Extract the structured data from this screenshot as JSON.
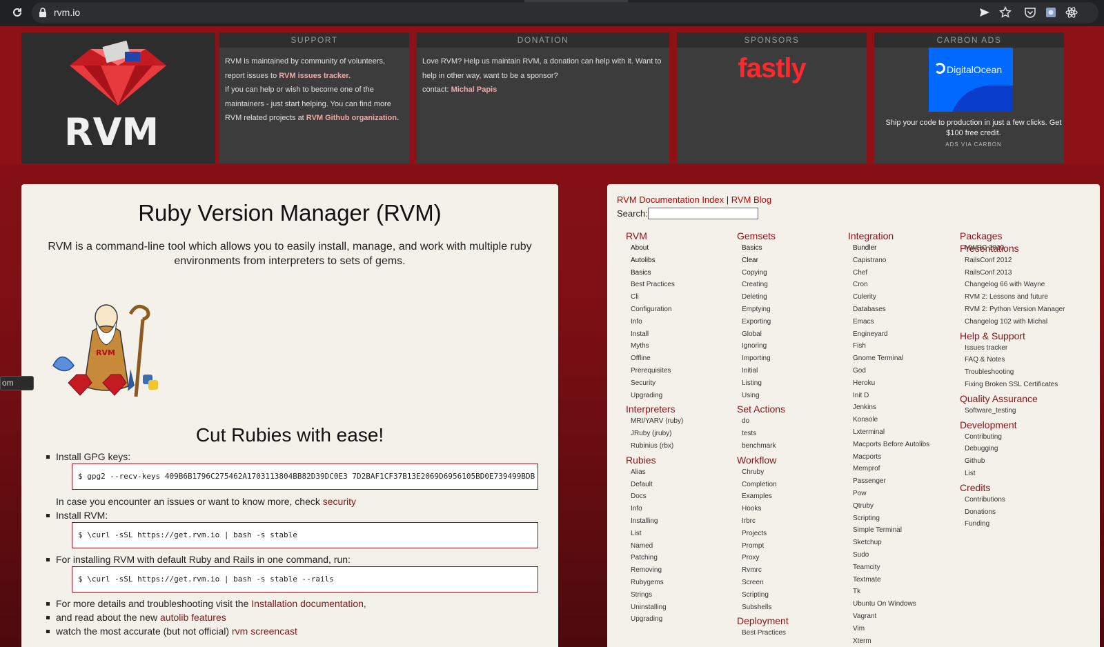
{
  "browser": {
    "url": "rvm.io"
  },
  "top": {
    "support": {
      "title": "SUPPORT",
      "line1": "RVM is maintained by community of volunteers,",
      "line2a": "report issues to ",
      "link_tracker": "RVM issues tracker.",
      "line3": "If you can help or wish to become one of the",
      "line4": "maintainers - just start helping. You can find more",
      "line5a": "RVM related projects at ",
      "link_github": "RVM Github organization."
    },
    "donation": {
      "title": "DONATION",
      "line1": "Love RVM? Help us maintain RVM, a donation can help with it. Want to",
      "line2": "help in other way, want to be a sponsor?",
      "line3a": "contact: ",
      "link_contact": "Michal Papis"
    },
    "sponsors": {
      "title": "SPONSORS",
      "name": "fastly"
    },
    "carbon": {
      "title": "CARBON ADS",
      "brand": "DigitalOcean",
      "text": "Ship your code to production in just a few clicks. Get $100 free credit.",
      "via": "ADS VIA CARBON"
    }
  },
  "main": {
    "title": "Ruby Version Manager (RVM)",
    "intro": "RVM is a command-line tool which allows you to easily install, manage, and work with multiple ruby environments from interpreters to sets of gems.",
    "subtitle": "Cut Rubies with ease!",
    "gpg_label": "Install GPG keys:",
    "gpg_code": "$ gpg2 --recv-keys 409B6B1796C275462A1703113804BB82D39DC0E3 7D2BAF1CF37B13E2069D6956105BD0E739499BDB",
    "security_text": "In case you encounter an issues or want to know more, check ",
    "security_link": "security",
    "install_label": "Install RVM:",
    "install_code": "$ \\curl -sSL https://get.rvm.io | bash -s stable",
    "rails_label": "For installing RVM with default Ruby and Rails in one command, run:",
    "rails_code": "$ \\curl -sSL https://get.rvm.io | bash -s stable --rails",
    "details_text": "For more details and troubleshooting visit the ",
    "details_link": "Installation documentation,",
    "autolib_text": "and read about the new ",
    "autolib_link": "autolib features",
    "screencast_text": "watch the most accurate (but not official) ",
    "screencast_link": "rvm screencast"
  },
  "tooltip_fragment": "om",
  "side": {
    "doc_index": "RVM Documentation Index",
    "sep": "|",
    "blog": "RVM Blog",
    "search_label": "Search:",
    "columns": [
      {
        "sections": [
          {
            "heading": "RVM",
            "items": [
              "About",
              "Autolibs",
              "Basics",
              "Best Practices",
              "Cli",
              "Configuration",
              "Info",
              "Install",
              "Myths",
              "Offline",
              "Prerequisites",
              "Security",
              "Upgrading"
            ]
          },
          {
            "heading": "Interpreters",
            "items": [
              "MRI/YARV (ruby)",
              "JRuby (jruby)",
              "Rubinius (rbx)"
            ]
          },
          {
            "heading": "Rubies",
            "items": [
              "Alias",
              "Default",
              "Docs",
              "Info",
              "Installing",
              "List",
              "Named",
              "Patching",
              "Removing",
              "Rubygems",
              "Strings",
              "Uninstalling",
              "Upgrading"
            ]
          }
        ]
      },
      {
        "sections": [
          {
            "heading": "Gemsets",
            "items": [
              "Basics",
              "Clear",
              "Copying",
              "Creating",
              "Deleting",
              "Emptying",
              "Exporting",
              "Global",
              "Ignoring",
              "Importing",
              "Initial",
              "Listing",
              "Using"
            ]
          },
          {
            "heading": "Set Actions",
            "items": [
              "do",
              "tests",
              "benchmark"
            ]
          },
          {
            "heading": "Workflow",
            "items": [
              "Chruby",
              "Completion",
              "Examples",
              "Hooks",
              "Irbrc",
              "Projects",
              "Prompt",
              "Proxy",
              "Rvmrc",
              "Screen",
              "Scripting",
              "Subshells"
            ]
          },
          {
            "heading": "Deployment",
            "items": [
              "Best Practices"
            ]
          }
        ]
      },
      {
        "sections": [
          {
            "heading": "Integration",
            "items": [
              "Bundler",
              "Capistrano",
              "Chef",
              "Cron",
              "Culerity",
              "Databases",
              "Emacs",
              "Engineyard",
              "Fish",
              "Gnome Terminal",
              "God",
              "Heroku",
              "Init D",
              "Jenkins",
              "Konsole",
              "Lxterminal",
              "Macports Before Autolibs",
              "Macports",
              "Memprof",
              "Passenger",
              "Pow",
              "Qtruby",
              "Scripting",
              "Simple Terminal",
              "Sketchup",
              "Sudo",
              "Teamcity",
              "Textmate",
              "Tk",
              "Ubuntu On Windows",
              "Vagrant",
              "Vim",
              "Xterm"
            ]
          }
        ]
      },
      {
        "sections": [
          {
            "heading": "Packages Presentations",
            "items": [
              "MWRC 2010",
              "RailsConf 2012",
              "RailsConf 2013",
              "Changelog 66 with Wayne",
              "RVM 2: Lessons and future",
              "RVM 2: Python Version Manager",
              "Changelog 102 with Michal"
            ]
          },
          {
            "heading": "Help & Support",
            "items": [
              "Issues tracker",
              "FAQ & Notes",
              "Troubleshooting",
              "Fixing Broken SSL Certificates"
            ]
          },
          {
            "heading": "Quality Assurance",
            "items": [
              "Software_testing"
            ]
          },
          {
            "heading": "Development",
            "items": [
              "Contributing",
              "Debugging",
              "Github",
              "List"
            ]
          },
          {
            "heading": "Credits",
            "items": [
              "Contributions",
              "Donations",
              "Funding"
            ]
          }
        ]
      }
    ]
  }
}
